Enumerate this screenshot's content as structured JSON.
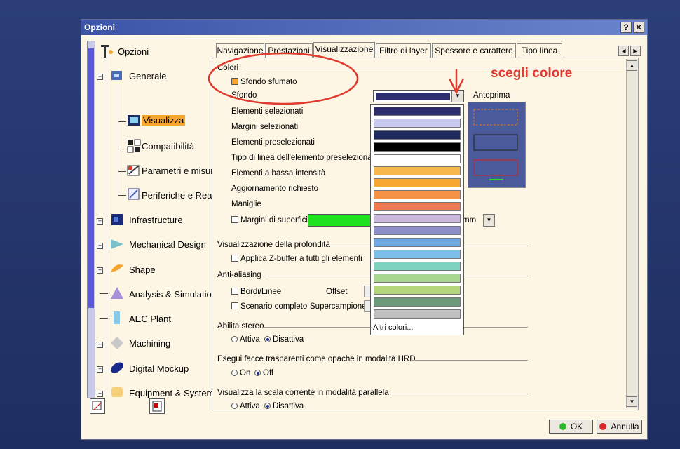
{
  "window": {
    "title": "Opzioni",
    "help_btn": "?",
    "close_btn": "✕"
  },
  "tree": {
    "root": "Opzioni",
    "items": [
      {
        "label": "Generale"
      },
      {
        "label": "Visualizza"
      },
      {
        "label": "Compatibilità"
      },
      {
        "label": "Parametri e misure"
      },
      {
        "label": "Periferiche e Realtà Virtuale"
      },
      {
        "label": "Infrastructure"
      },
      {
        "label": "Mechanical Design"
      },
      {
        "label": "Shape"
      },
      {
        "label": "Analysis & Simulation"
      },
      {
        "label": "AEC Plant"
      },
      {
        "label": "Machining"
      },
      {
        "label": "Digital Mockup"
      },
      {
        "label": "Equipment & Systems"
      }
    ]
  },
  "tabs": [
    "Navigazione",
    "Prestazioni",
    "Visualizzazione",
    "Filtro di layer",
    "Spessore e carattere",
    "Tipo linea"
  ],
  "panel": {
    "colori_title": "Colori",
    "sfondo_sfumato": "Sfondo sfumato",
    "sfondo": "Sfondo",
    "anteprima": "Anteprima",
    "rows": [
      "Elementi selezionati",
      "Margini selezionati",
      "Elementi preselezionati",
      "Tipo di linea dell'elemento preselezionato",
      "Elementi a bassa intensità",
      "Aggiornamento richiesto",
      "Maniglie"
    ],
    "margini_superfici": "Margini di superfici",
    "mm_unit": "mm",
    "profondita_title": "Visualizzazione della profondità",
    "zbuffer": "Applica Z-buffer a tutti gli elementi",
    "antialias_title": "Anti-aliasing",
    "bordi": "Bordi/Linee",
    "offset": "Offset",
    "scenario": "Scenario completo",
    "supercampione": "Supercampione",
    "stereo_title": "Abilita stereo",
    "attiva": "Attiva",
    "disattiva": "Disattiva",
    "hrd_title": "Esegui facce trasparenti come opache in modalità HRD",
    "on": "On",
    "off": "Off",
    "scala_title": "Visualizza la scala corrente in modalità parallela",
    "attiva2": "Attiva",
    "disattiva2": "Disattiva"
  },
  "dropdown": {
    "more_colors": "Altri colori...",
    "swatches": [
      "#2e2e6e",
      "#c8c8f0",
      "#1e2a5e",
      "#000000",
      "#ffffff",
      "#f6b84a",
      "#f7a832",
      "#f49245",
      "#ef7a52",
      "#c9b7dc",
      "#8e8ec8",
      "#6ea8e0",
      "#7cc0e8",
      "#80d2c0",
      "#a8d890",
      "#b6d67a",
      "#6a9a7a",
      "#c0c0c0"
    ]
  },
  "annotation": {
    "text": "scegli colore",
    "color": "#e0392e"
  },
  "buttons": {
    "ok": "OK",
    "annulla": "Annulla"
  }
}
